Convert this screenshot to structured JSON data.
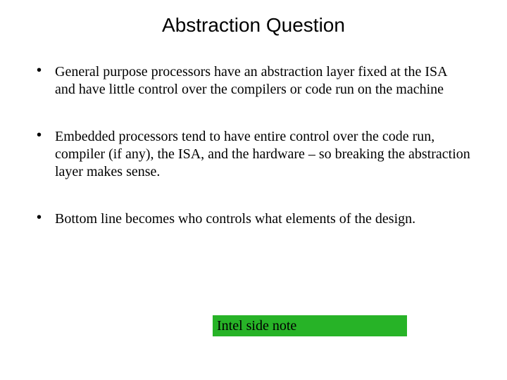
{
  "title": "Abstraction Question",
  "bullets": [
    "General purpose processors have an abstraction layer fixed at the ISA and have little control over the compilers or code run on the machine",
    "Embedded processors tend to have entire control over the code run, compiler (if any), the ISA, and the hardware – so breaking the abstraction layer makes sense.",
    "Bottom line becomes who controls what elements of the design."
  ],
  "note": "Intel side note"
}
